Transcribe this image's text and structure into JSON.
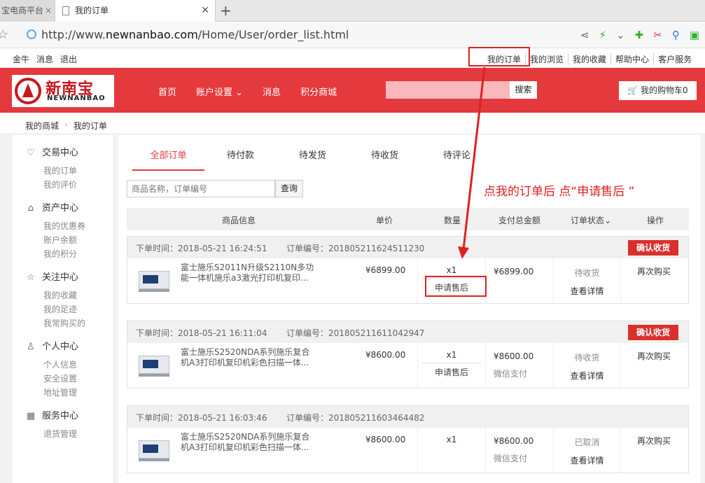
{
  "browser": {
    "inactive_tab": "宝电商平台",
    "active_tab": "我的订单",
    "url_prefix": "http://www.",
    "url_domain": "newnanbao.com",
    "url_path": "/Home/User/order_list.html"
  },
  "toplinks": {
    "left": [
      "金牛",
      "消息",
      "退出"
    ],
    "right": [
      "我的订单",
      "我的浏览",
      "我的收藏",
      "帮助中心",
      "客户服务"
    ]
  },
  "header": {
    "logo_cn": "新南宝",
    "logo_en": "NEWNANBAO",
    "nav": [
      "首页",
      "账户设置 ⌄",
      "消息",
      "积分商城"
    ],
    "search_button": "搜索",
    "cart": "🛒 我的购物车0",
    "accent": "#e43a3d"
  },
  "breadcrumb": [
    "我的商城",
    "我的订单"
  ],
  "sidebar": [
    {
      "title": "交易中心",
      "icon": "handshake-icon",
      "items": [
        "我的订单",
        "我的评价"
      ]
    },
    {
      "title": "资产中心",
      "icon": "home-icon",
      "items": [
        "我的优惠券",
        "账户余额",
        "我的积分"
      ]
    },
    {
      "title": "关注中心",
      "icon": "star-icon",
      "items": [
        "我的收藏",
        "我的足迹",
        "我常购买的"
      ]
    },
    {
      "title": "个人中心",
      "icon": "user-icon",
      "items": [
        "个人信息",
        "安全设置",
        "地址管理"
      ]
    },
    {
      "title": "服务中心",
      "icon": "building-icon",
      "items": [
        "退货管理"
      ]
    }
  ],
  "tabs": [
    "全部订单",
    "待付款",
    "待发货",
    "待收货",
    "待评论"
  ],
  "query": {
    "placeholder": "商品名称，订单编号",
    "button": "查询"
  },
  "annotation": "点我的订单后 点“申请售后 ”",
  "table_headers": [
    "商品信息",
    "单价",
    "数量",
    "支付总金额",
    "订单状态⌄",
    "操作"
  ],
  "orders": [
    {
      "time": "下单时间：2018-05-21 16:24:51",
      "no": "订单编号：201805211624511230",
      "confirm": "确认收货",
      "name": "富士施乐S2011N升级S2110N多功能一体机施乐a3激光打印机复印...",
      "price": "¥6899.00",
      "qty": "x1",
      "after_sale": "申请售后",
      "total": "¥6899.00",
      "pay": "",
      "status": "待收货",
      "detail": "查看详情",
      "rebuy": "再次购买"
    },
    {
      "time": "下单时间：2018-05-21 16:11:04",
      "no": "订单编号：201805211611042947",
      "confirm": "确认收货",
      "name": "富士施乐S2520NDA系列施乐复合机A3打印机复印机彩色扫描一体...",
      "price": "¥8600.00",
      "qty": "x1",
      "after_sale": "申请售后",
      "total": "¥8600.00",
      "pay": "微信支付",
      "status": "待收货",
      "detail": "查看详情",
      "rebuy": "再次购买"
    },
    {
      "time": "下单时间：2018-05-21 16:03:46",
      "no": "订单编号：201805211603464482",
      "confirm": "",
      "name": "富士施乐S2520NDA系列施乐复合机A3打印机复印机彩色扫描一体...",
      "price": "¥8600.00",
      "qty": "x1",
      "after_sale": "",
      "total": "¥8600.00",
      "pay": "微信支付",
      "status": "已取消",
      "detail": "查看详情",
      "rebuy": "再次购买"
    }
  ]
}
